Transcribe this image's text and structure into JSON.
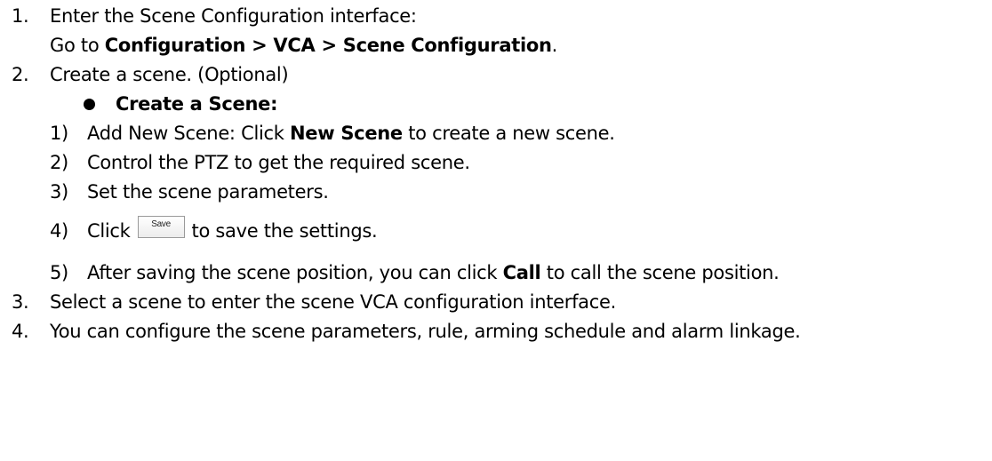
{
  "steps": {
    "s1_num": "1.",
    "s1_text": "Enter the Scene Configuration interface:",
    "s1_sub_prefix": "Go to ",
    "s1_sub_bold": "Configuration > VCA > Scene Configuration",
    "s1_sub_suffix": ".",
    "s2_num": "2.",
    "s2_text": "Create a scene. (Optional)",
    "s2_bullet_title": "Create a Scene:",
    "sub": [
      {
        "num": "1)",
        "prefix": "Add New Scene: Click ",
        "bold": "New Scene",
        "suffix": " to create a new scene."
      },
      {
        "num": "2)",
        "text": "Control the PTZ to get the required scene."
      },
      {
        "num": "3)",
        "text": "Set the scene parameters."
      },
      {
        "num": "4)",
        "prefix": "Click",
        "button": "Save",
        "suffix": "to save the settings."
      },
      {
        "num": "5)",
        "prefix": "After saving the scene position, you can click ",
        "bold": "Call",
        "suffix": " to call the scene position."
      }
    ],
    "s3_num": "3.",
    "s3_text": "Select a scene to enter the scene VCA configuration interface.",
    "s4_num": "4.",
    "s4_text": "You can configure the scene parameters, rule, arming schedule and alarm linkage."
  }
}
